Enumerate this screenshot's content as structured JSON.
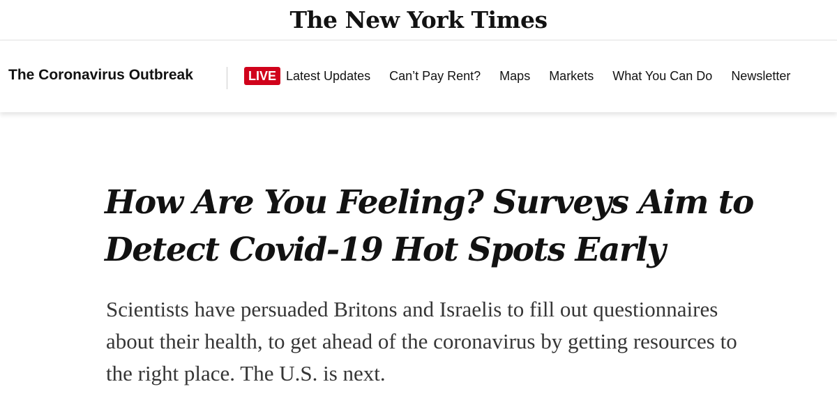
{
  "masthead": {
    "logo_text": "The New York Times"
  },
  "navbar": {
    "section_title": "The Coronavirus Outbreak",
    "live_label": "LIVE",
    "items": [
      {
        "label": "Latest Updates"
      },
      {
        "label": "Can’t Pay Rent?"
      },
      {
        "label": "Maps"
      },
      {
        "label": "Markets"
      },
      {
        "label": "What You Can Do"
      },
      {
        "label": "Newsletter"
      }
    ]
  },
  "article": {
    "headline": "How Are You Feeling? Surveys Aim to Detect Covid-19 Hot Spots Early",
    "summary": "Scientists have persuaded Britons and Israelis to fill out questionnaires about their health, to get ahead of the coronavirus by getting resources to the right place. The U.S. is next."
  },
  "colors": {
    "live_badge": "#d0021b",
    "text": "#121212",
    "summary_text": "#363636"
  }
}
